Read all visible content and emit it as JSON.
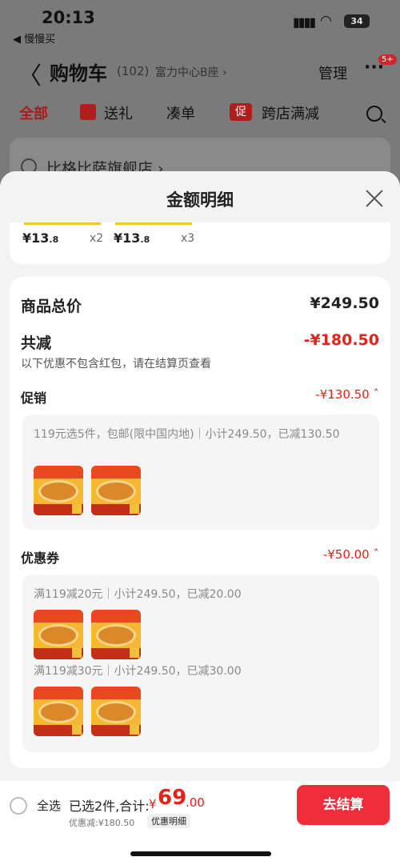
{
  "status": {
    "time": "20:13",
    "back_app": "◀ 慢慢买",
    "signal": "▮▮▮▮",
    "wifi": "◠",
    "battery": "34"
  },
  "nav": {
    "back": "〈",
    "title": "购物车",
    "count": "(102)",
    "location": "富力中心B座 ›",
    "manage": "管理",
    "more": "···",
    "badge": "5+"
  },
  "tabs": {
    "all": "全部",
    "gift": "送礼",
    "combine": "凑单",
    "promo_icon": "促",
    "cross_store": "跨店满减"
  },
  "store": {
    "name": "比格比萨旗舰店 ›"
  },
  "sheet": {
    "title": "金额明细",
    "peek": [
      {
        "price_int": "¥13",
        "price_dec": ".8",
        "qty": "x2"
      },
      {
        "price_int": "¥13",
        "price_dec": ".8",
        "qty": "x3"
      }
    ],
    "goods_total_label": "商品总价",
    "goods_total_value": "¥249.50",
    "reduce_label": "共减",
    "reduce_value": "-¥180.50",
    "reduce_note": "以下优惠不包含红包，请在结算页查看",
    "promo_label": "促销",
    "promo_value": "-¥130.50 ˆ",
    "promo_desc": "119元选5件，包邮(限中国内地)｜小计249.50，已减130.50",
    "coupon_label": "优惠券",
    "coupon_value": "-¥50.00 ˆ",
    "coupon1_desc": "满119减20元｜小计249.50，已减20.00",
    "coupon2_desc": "满119减30元｜小计249.50，已减30.00"
  },
  "bottom": {
    "select_all": "全选",
    "selected": "已选2件,合计:",
    "currency": "¥",
    "total_int": "69",
    "total_dec": ".00",
    "discount": "优惠减:¥180.50",
    "detail_btn": "优惠明细",
    "checkout": "去结算"
  },
  "colors": {
    "accent_red": "#e2231a",
    "checkout_bg": "#f02d3a"
  },
  "icons": {
    "close": "close-icon",
    "search": "search-icon",
    "gift": "gift-icon"
  }
}
